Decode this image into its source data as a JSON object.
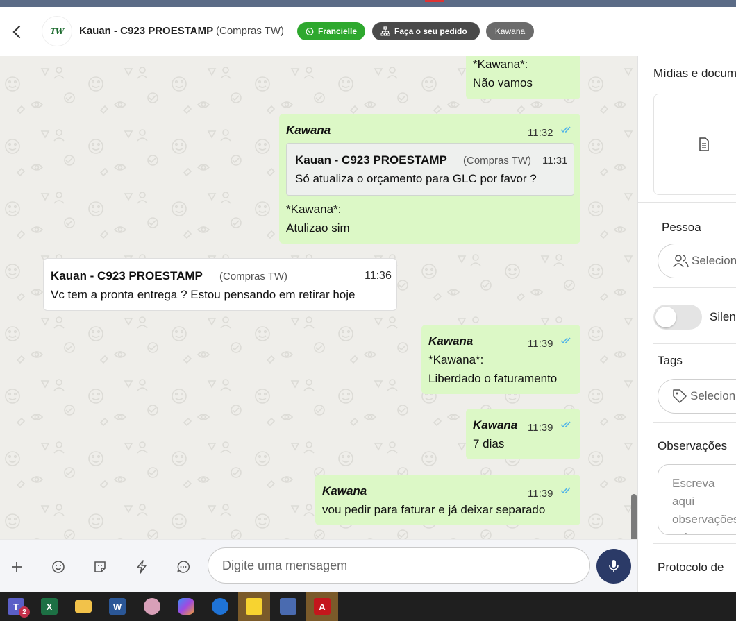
{
  "header": {
    "back_icon": "chevron-left-icon",
    "logo_text": "TW",
    "contact_name": "Kauan - C923 PROESTAMP",
    "contact_company": "(Compras TW)",
    "chips": {
      "agent": "Francielle",
      "agent_color": "#2ea82e",
      "flow": "Faça o seu pedido",
      "flow_color": "#4a4a4a",
      "queue": "Kawana",
      "queue_color": "#6b6b6b"
    }
  },
  "messages": [
    {
      "direction": "out",
      "line1": "*Kawana*:",
      "line2": "Não vamos"
    },
    {
      "direction": "out",
      "sender": "Kawana",
      "time": "11:32",
      "quote": {
        "sender": "Kauan - C923 PROESTAMP",
        "company": "(Compras TW)",
        "time": "11:31",
        "text": "Só atualiza o orçamento para GLC por favor ?"
      },
      "line1": "*Kawana*:",
      "line2": "Atulizao sim"
    },
    {
      "direction": "in",
      "sender": "Kauan - C923 PROESTAMP",
      "company": "(Compras TW)",
      "time": "11:36",
      "text": "Vc tem a pronta entrega ? Estou pensando em retirar hoje"
    },
    {
      "direction": "out",
      "sender": "Kawana",
      "time": "11:39",
      "line1": "*Kawana*:",
      "line2": "Liberdado o faturamento"
    },
    {
      "direction": "out",
      "sender": "Kawana",
      "time": "11:39",
      "text": "7 dias"
    },
    {
      "direction": "out",
      "sender": "Kawana",
      "time": "11:39",
      "text": "vou pedir para faturar e já deixar separado"
    }
  ],
  "composer": {
    "placeholder": "Digite uma mensagem",
    "icons": [
      "plus-icon",
      "emoji-icon",
      "sticker-icon",
      "lightning-icon",
      "chat-bubble-icon",
      "microphone-icon"
    ],
    "mic_color": "#2b3a67"
  },
  "side_panel": {
    "media_title": "Mídias e documentos",
    "person_title": "Pessoa",
    "person_placeholder": "Selecionar",
    "silence_label": "Silenciar",
    "silence_on": false,
    "tags_title": "Tags",
    "tags_placeholder": "Selecionar",
    "notes_title": "Observações",
    "notes_placeholder": "Escreva aqui observações sobre o atendimento",
    "protocol_title": "Protocolo de"
  },
  "taskbar": {
    "items": [
      "teams-icon",
      "excel-icon",
      "file-explorer-icon",
      "word-icon",
      "paint-icon",
      "copilot-icon",
      "thunderbird-icon",
      "sticky-notes-icon",
      "calculator-icon",
      "acrobat-icon"
    ],
    "teams_badge": "2"
  },
  "colors": {
    "outgoing_bubble": "#dcf8c6",
    "chat_background": "#efeeea",
    "read_tick": "#4fb3e8"
  }
}
